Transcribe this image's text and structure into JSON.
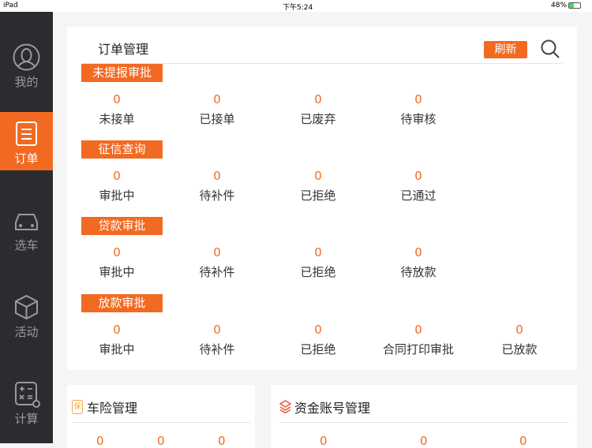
{
  "status": {
    "device": "iPad",
    "time": "下午5:24",
    "battery": "48%"
  },
  "sidebar": [
    {
      "label": "我的",
      "icon": "user-icon"
    },
    {
      "label": "订单",
      "icon": "list-icon",
      "active": true
    },
    {
      "label": "选车",
      "icon": "car-icon"
    },
    {
      "label": "活动",
      "icon": "box-icon"
    },
    {
      "label": "计算",
      "icon": "calculator-icon"
    }
  ],
  "orders": {
    "title": "订单管理",
    "refresh": "刷新",
    "sections": [
      {
        "name": "未提报审批",
        "items": [
          {
            "n": "0",
            "l": "未接单"
          },
          {
            "n": "0",
            "l": "已接单"
          },
          {
            "n": "0",
            "l": "已废弃"
          },
          {
            "n": "0",
            "l": "待审核"
          }
        ]
      },
      {
        "name": "征信查询",
        "items": [
          {
            "n": "0",
            "l": "审批中"
          },
          {
            "n": "0",
            "l": "待补件"
          },
          {
            "n": "0",
            "l": "已拒绝"
          },
          {
            "n": "0",
            "l": "已通过"
          }
        ]
      },
      {
        "name": "贷款审批",
        "items": [
          {
            "n": "0",
            "l": "审批中"
          },
          {
            "n": "0",
            "l": "待补件"
          },
          {
            "n": "0",
            "l": "已拒绝"
          },
          {
            "n": "0",
            "l": "待放款"
          }
        ]
      },
      {
        "name": "放款审批",
        "items": [
          {
            "n": "0",
            "l": "审批中"
          },
          {
            "n": "0",
            "l": "待补件"
          },
          {
            "n": "0",
            "l": "已拒绝"
          },
          {
            "n": "0",
            "l": "合同打印审批"
          },
          {
            "n": "0",
            "l": "已放款"
          }
        ]
      }
    ]
  },
  "insurance": {
    "title": "车险管理",
    "icon_text": "保",
    "nums": [
      "0",
      "0",
      "0"
    ]
  },
  "funds": {
    "title": "资金账号管理",
    "nums": [
      "0",
      "0",
      "0"
    ]
  },
  "colors": {
    "accent": "#f26a22",
    "sidebar": "#2b2c30"
  }
}
